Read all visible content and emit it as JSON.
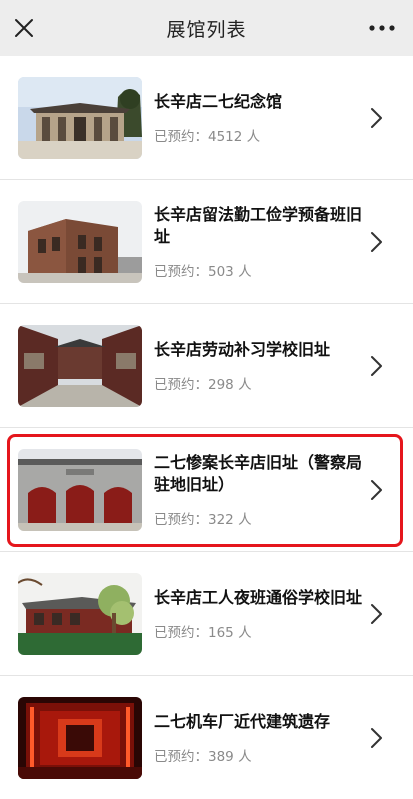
{
  "header": {
    "title": "展馆列表",
    "close_icon": "close-icon",
    "more_icon": "more-dots-icon"
  },
  "booked_prefix": "已预约：",
  "booked_suffix": " 人",
  "venues": [
    {
      "name": "长辛店二七纪念馆",
      "booked": "4512",
      "image": "memorial-hall-photo"
    },
    {
      "name": "长辛店留法勤工俭学预备班旧址",
      "booked": "503",
      "image": "brick-building-photo"
    },
    {
      "name": "长辛店劳动补习学校旧址",
      "booked": "298",
      "image": "courtyard-photo"
    },
    {
      "name": "二七惨案长辛店旧址（警察局驻地旧址）",
      "booked": "322",
      "image": "red-doors-gate-photo"
    },
    {
      "name": "长辛店工人夜班通俗学校旧址",
      "booked": "165",
      "image": "tree-building-photo"
    },
    {
      "name": "二七机车厂近代建筑遗存",
      "booked": "389",
      "image": "red-exhibit-hall-photo"
    }
  ],
  "colors": {
    "highlight": "#e5161c",
    "header_bg": "#ededed",
    "muted_text": "#8a8a8a"
  }
}
